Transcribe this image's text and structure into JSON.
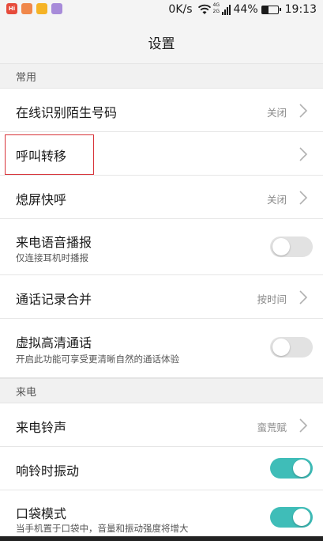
{
  "status_bar": {
    "apps": [
      "Hi",
      "",
      "",
      ""
    ],
    "net_speed": "0K/s",
    "signal_top": "4G",
    "signal_bottom": "2G",
    "battery": "44%",
    "time": "19:13"
  },
  "title": "设置",
  "sections": [
    {
      "header": "常用",
      "rows": [
        {
          "label": "在线识别陌生号码",
          "value": "关闭",
          "control": "chevron"
        },
        {
          "label": "呼叫转移",
          "value": "",
          "control": "chevron"
        },
        {
          "label": "熄屏快呼",
          "value": "关闭",
          "control": "chevron"
        },
        {
          "label": "来电语音播报",
          "sub": "仅连接耳机时播报",
          "control": "toggle",
          "on": false
        },
        {
          "label": "通话记录合并",
          "value": "按时间",
          "control": "chevron"
        },
        {
          "label": "虚拟高清通话",
          "sub": "开启此功能可享受更清晰自然的通话体验",
          "control": "toggle",
          "on": false
        }
      ]
    },
    {
      "header": "来电",
      "rows": [
        {
          "label": "来电铃声",
          "value": "蛮荒赋",
          "control": "chevron"
        },
        {
          "label": "响铃时振动",
          "control": "toggle",
          "on": true
        },
        {
          "label": "口袋模式",
          "sub": "当手机置于口袋中，音量和振动强度将增大",
          "control": "toggle",
          "on": true
        }
      ]
    }
  ],
  "colors": {
    "accent": "#3fbdb8",
    "highlight": "#d8343a"
  }
}
